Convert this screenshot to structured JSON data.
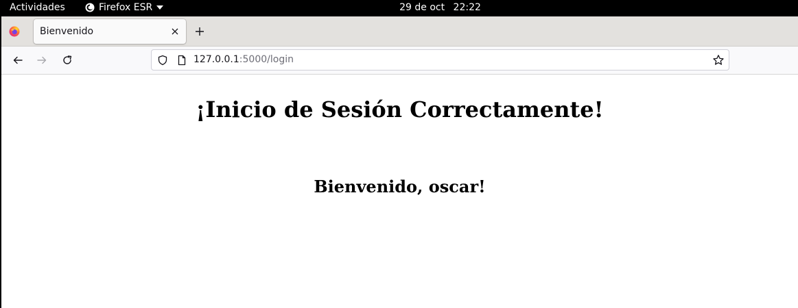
{
  "topbar": {
    "activities_label": "Actividades",
    "app_name": "Firefox ESR",
    "date": "29 de oct",
    "time": "22:22"
  },
  "browser": {
    "tab": {
      "title": "Bienvenido"
    },
    "url": {
      "host": "127.0.0.1",
      "rest": ":5000/login"
    }
  },
  "page": {
    "title": "¡Inicio de Sesión Correctamente!",
    "welcome": "Bienvenido, oscar!"
  },
  "icons": {
    "app": "firefox-icon",
    "tab_close": "close-icon",
    "new_tab": "plus-icon",
    "back": "arrow-left-icon",
    "forward": "arrow-right-icon",
    "reload": "reload-icon",
    "tracking_protection": "shield-icon",
    "page_info": "page-icon",
    "bookmark": "star-icon"
  }
}
